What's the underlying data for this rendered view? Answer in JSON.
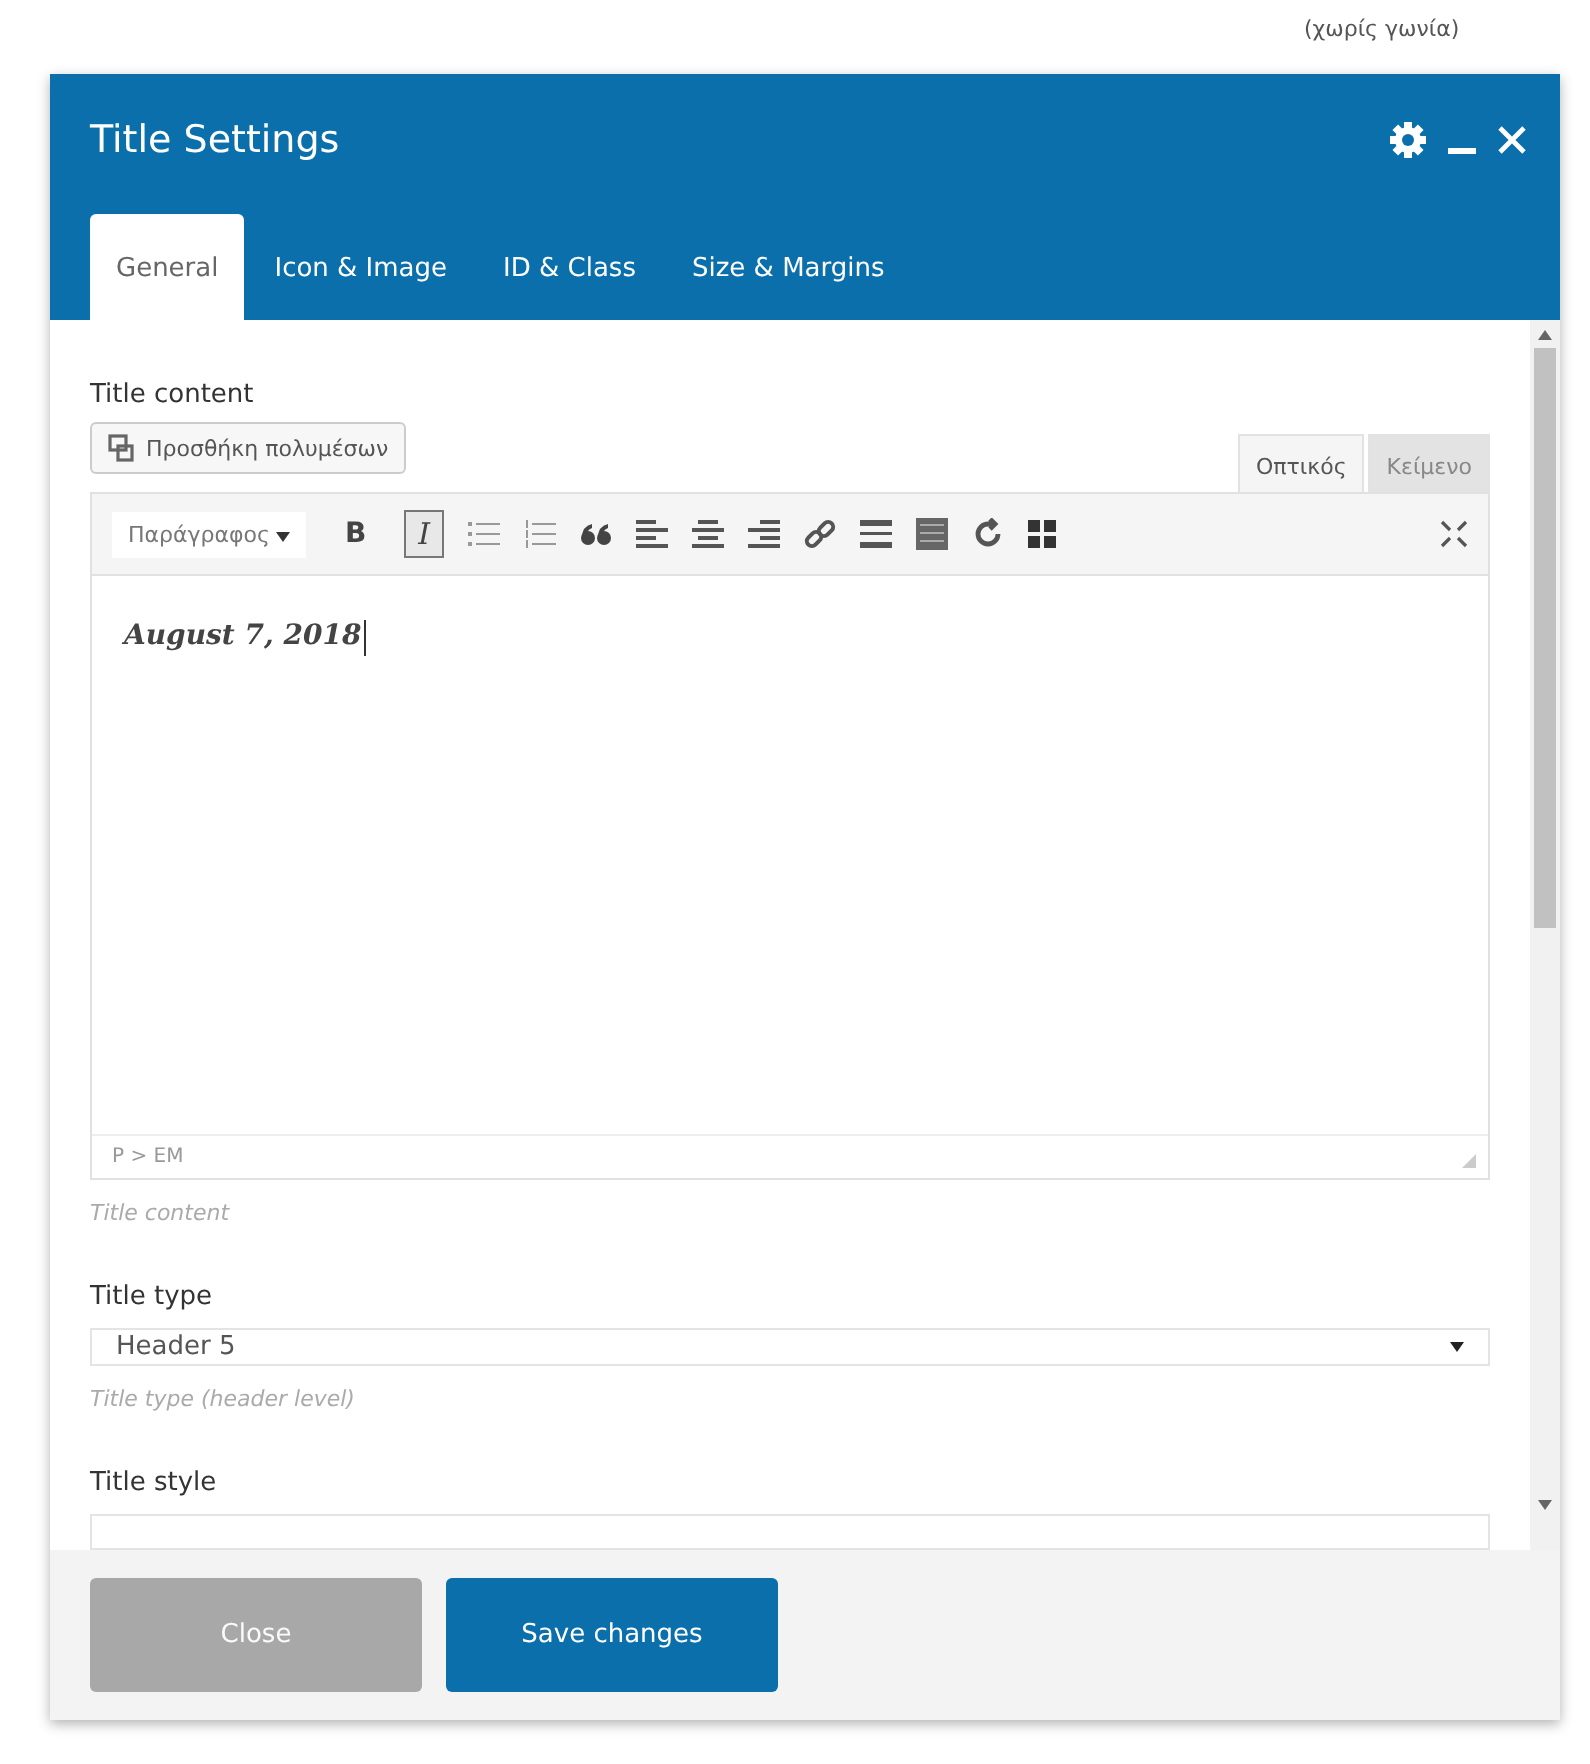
{
  "background": {
    "corner_text": "(χωρίς γωνία)"
  },
  "window": {
    "title": "Title Settings"
  },
  "tabs": [
    {
      "label": "General",
      "selected": true
    },
    {
      "label": "Icon & Image",
      "selected": false
    },
    {
      "label": "ID & Class",
      "selected": false
    },
    {
      "label": "Size & Margins",
      "selected": false
    }
  ],
  "title_content": {
    "label": "Title content",
    "add_media": "Προσθήκη πολυμέσων",
    "editor_tabs": [
      {
        "label": "Οπτικός",
        "selected": true
      },
      {
        "label": "Κείμενο",
        "selected": false
      }
    ],
    "format_select": "Παράγραφος",
    "format_buttons": [
      {
        "label": "B",
        "active": false
      },
      {
        "label": "I",
        "active": true
      }
    ],
    "content": "August 7, 2018",
    "path": "P > EM",
    "description": "Title content"
  },
  "title_type": {
    "label": "Title type",
    "value": "Header 5",
    "description": "Title type (header level)"
  },
  "title_style": {
    "label": "Title style"
  },
  "buttons": [
    {
      "label": "Close",
      "disabled": true
    },
    {
      "label": "Save changes",
      "disabled": false
    }
  ]
}
